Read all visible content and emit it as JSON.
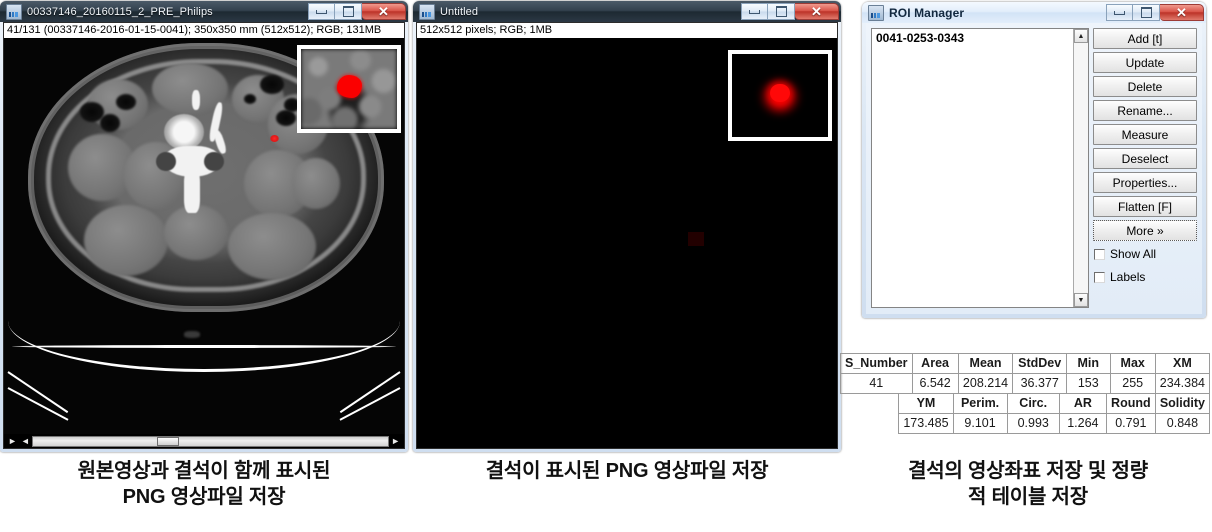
{
  "windows": {
    "ct_window": {
      "title": "00337146_20160115_2_PRE_Philips",
      "info": "41/131 (00337146-2016-01-15-0041); 350x350 mm (512x512); RGB; 131MB",
      "minimize_label": "Minimize",
      "maximize_label": "Maximize",
      "close_label": "Close"
    },
    "png_window": {
      "title": "Untitled",
      "info": "512x512 pixels; RGB; 1MB",
      "minimize_label": "Minimize",
      "maximize_label": "Maximize",
      "close_label": "Close"
    },
    "roi_manager": {
      "title": "ROI Manager",
      "minimize_label": "Minimize",
      "maximize_label": "Maximize",
      "close_label": "Close",
      "list_items": [
        "0041-0253-0343"
      ],
      "buttons": [
        "Add [t]",
        "Update",
        "Delete",
        "Rename...",
        "Measure",
        "Deselect",
        "Properties...",
        "Flatten [F]",
        "More »"
      ],
      "checkboxes": [
        {
          "label": "Show All",
          "checked": false
        },
        {
          "label": "Labels",
          "checked": false
        }
      ]
    }
  },
  "results_table": {
    "row1_headers": [
      "S_Number",
      "Area",
      "Mean",
      "StdDev",
      "Min",
      "Max",
      "XM"
    ],
    "row1_values": [
      "41",
      "6.542",
      "208.214",
      "36.377",
      "153",
      "255",
      "234.384"
    ],
    "row2_headers": [
      "YM",
      "Perim.",
      "Circ.",
      "AR",
      "Round",
      "Solidity"
    ],
    "row2_values": [
      "173.485",
      "9.101",
      "0.993",
      "1.264",
      "0.791",
      "0.848"
    ]
  },
  "captions": {
    "left_line1": "원본영상과 결석이 함께 표시된",
    "left_line2": "PNG 영상파일 저장",
    "center_line1": "결석이 표시된 PNG 영상파일 저장",
    "right_line1": "결석의 영상좌표 저장 및 정량",
    "right_line2": "적 테이블 저장"
  },
  "colors": {
    "roi_red": "#ff0000",
    "close_button": "#c3392e",
    "titlebar_dark": "#2b3844"
  },
  "icons": {
    "scroll_left": "◄",
    "scroll_right": "►",
    "scroll_play": "►",
    "scroll_up": "▲",
    "scroll_down": "▼",
    "close": "✕"
  }
}
